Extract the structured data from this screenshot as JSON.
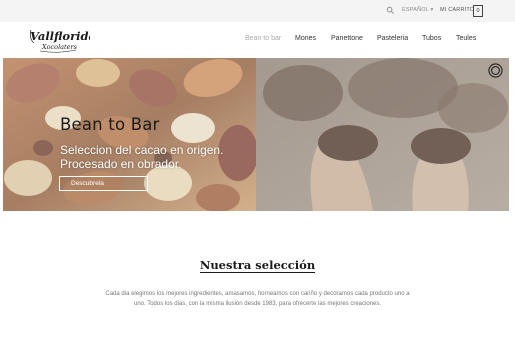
{
  "topbar": {
    "language": "ESPAÑOL ▾",
    "cart_label": "MI CARRITO",
    "cart_count": "0"
  },
  "brand": {
    "logo_text": "Vallflorida",
    "logo_subtext": "Xocolaters"
  },
  "nav": {
    "items": [
      {
        "label": "Bean to bar",
        "active": true
      },
      {
        "label": "Mones"
      },
      {
        "label": "Panettone"
      },
      {
        "label": "Pasteleria"
      },
      {
        "label": "Tubos"
      },
      {
        "label": "Teules"
      }
    ]
  },
  "hero": {
    "title": "Bean to Bar",
    "subtitle_line1": "Seleccion del cacao en origen.",
    "subtitle_line2": "Procesado en obrador.",
    "button_label": "Descubrela"
  },
  "section": {
    "title": "Nuestra selección",
    "text": "Cada dia elegimos los mejores ingredientes, amasamos, horneamos con cariño y decoramos cada producto uno a uno. Todos los dias, con la misma ilusión desde 1983, para ofrecerte las mejores creaciones."
  },
  "colors": {
    "topbar_bg": "#f4f4f4",
    "active_nav": "#aaaaaa",
    "text_dark": "#1a1a1a"
  }
}
